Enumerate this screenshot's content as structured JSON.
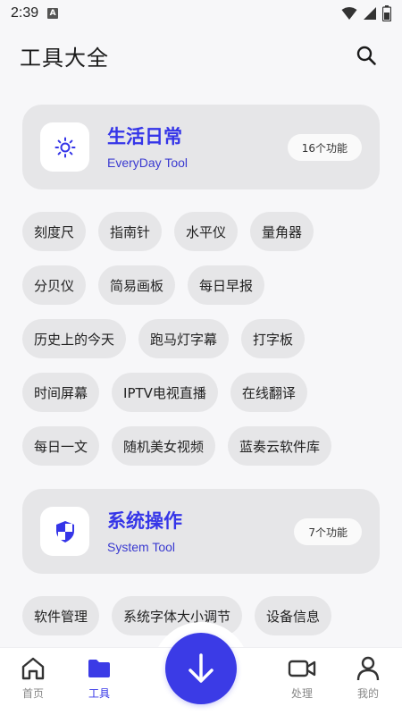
{
  "status": {
    "time": "2:39",
    "notif": "A"
  },
  "header": {
    "title": "工具大全"
  },
  "sections": [
    {
      "title": "生活日常",
      "subtitle": "EveryDay Tool",
      "badge": "16个功能",
      "icon": "sun-icon",
      "rows": [
        [
          "刻度尺",
          "指南针",
          "水平仪",
          "量角器"
        ],
        [
          "分贝仪",
          "简易画板",
          "每日早报"
        ],
        [
          "历史上的今天",
          "跑马灯字幕",
          "打字板"
        ],
        [
          "时间屏幕",
          "IPTV电视直播",
          "在线翻译"
        ],
        [
          "每日一文",
          "随机美女视频",
          "蓝奏云软件库"
        ]
      ]
    },
    {
      "title": "系统操作",
      "subtitle": "System Tool",
      "badge": "7个功能",
      "icon": "shield-icon",
      "rows": [
        [
          "软件管理",
          "系统字体大小调节",
          "设备信息"
        ]
      ]
    }
  ],
  "nav": {
    "home": "首页",
    "tools": "工具",
    "process": "处理",
    "mine": "我的",
    "active": "tools"
  },
  "colors": {
    "accent": "#3b3be6",
    "card": "#e6e6e8",
    "background": "#f7f7f9"
  }
}
